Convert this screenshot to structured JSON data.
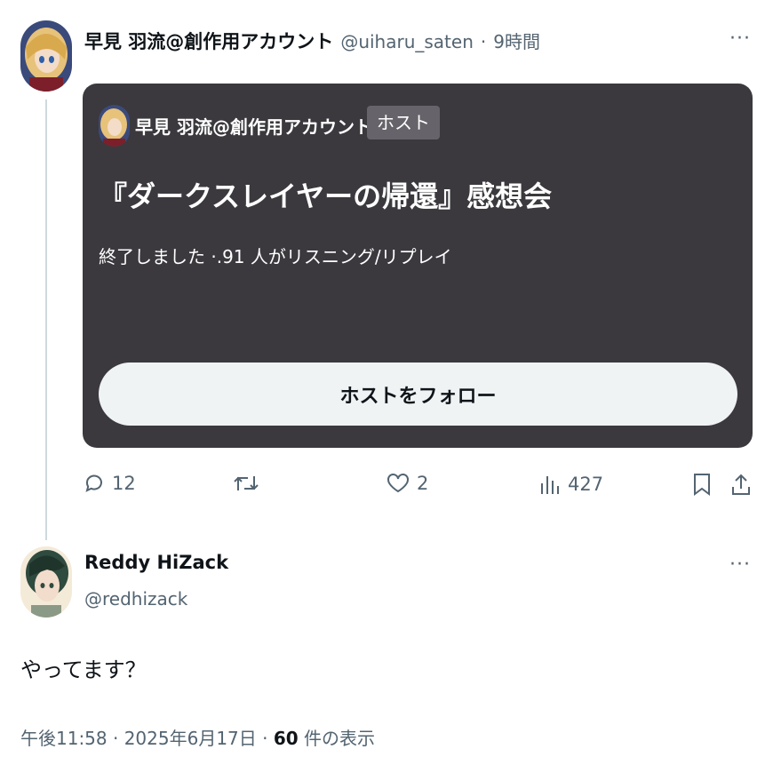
{
  "tweet": {
    "author_name": "早見 羽流@創作用アカウント",
    "handle": "@uiharu_saten",
    "separator": "·",
    "time": "9時間",
    "more": "···"
  },
  "space_card": {
    "host_name": "早見 羽流@創作用アカウント",
    "host_badge": "ホスト",
    "title": "『ダークスレイヤーの帰還』感想会",
    "status": "終了しました ·.91 人がリスニング/リプレイ",
    "follow_button": "ホストをフォロー"
  },
  "actions": {
    "replies": "12",
    "retweets": "",
    "likes": "2",
    "views": "427"
  },
  "reply": {
    "author_name": "Reddy HiZack",
    "handle": "@redhizack",
    "more": "···",
    "text": "やってます？",
    "meta_time": "午後11:58 · 2025年6月17日 · ",
    "meta_views": "60",
    "meta_views_label": " 件の表示"
  },
  "colors": {
    "card_bg": "#3b393e",
    "badge_bg": "#66646a",
    "button_bg": "#eff3f4",
    "muted": "#536471"
  }
}
